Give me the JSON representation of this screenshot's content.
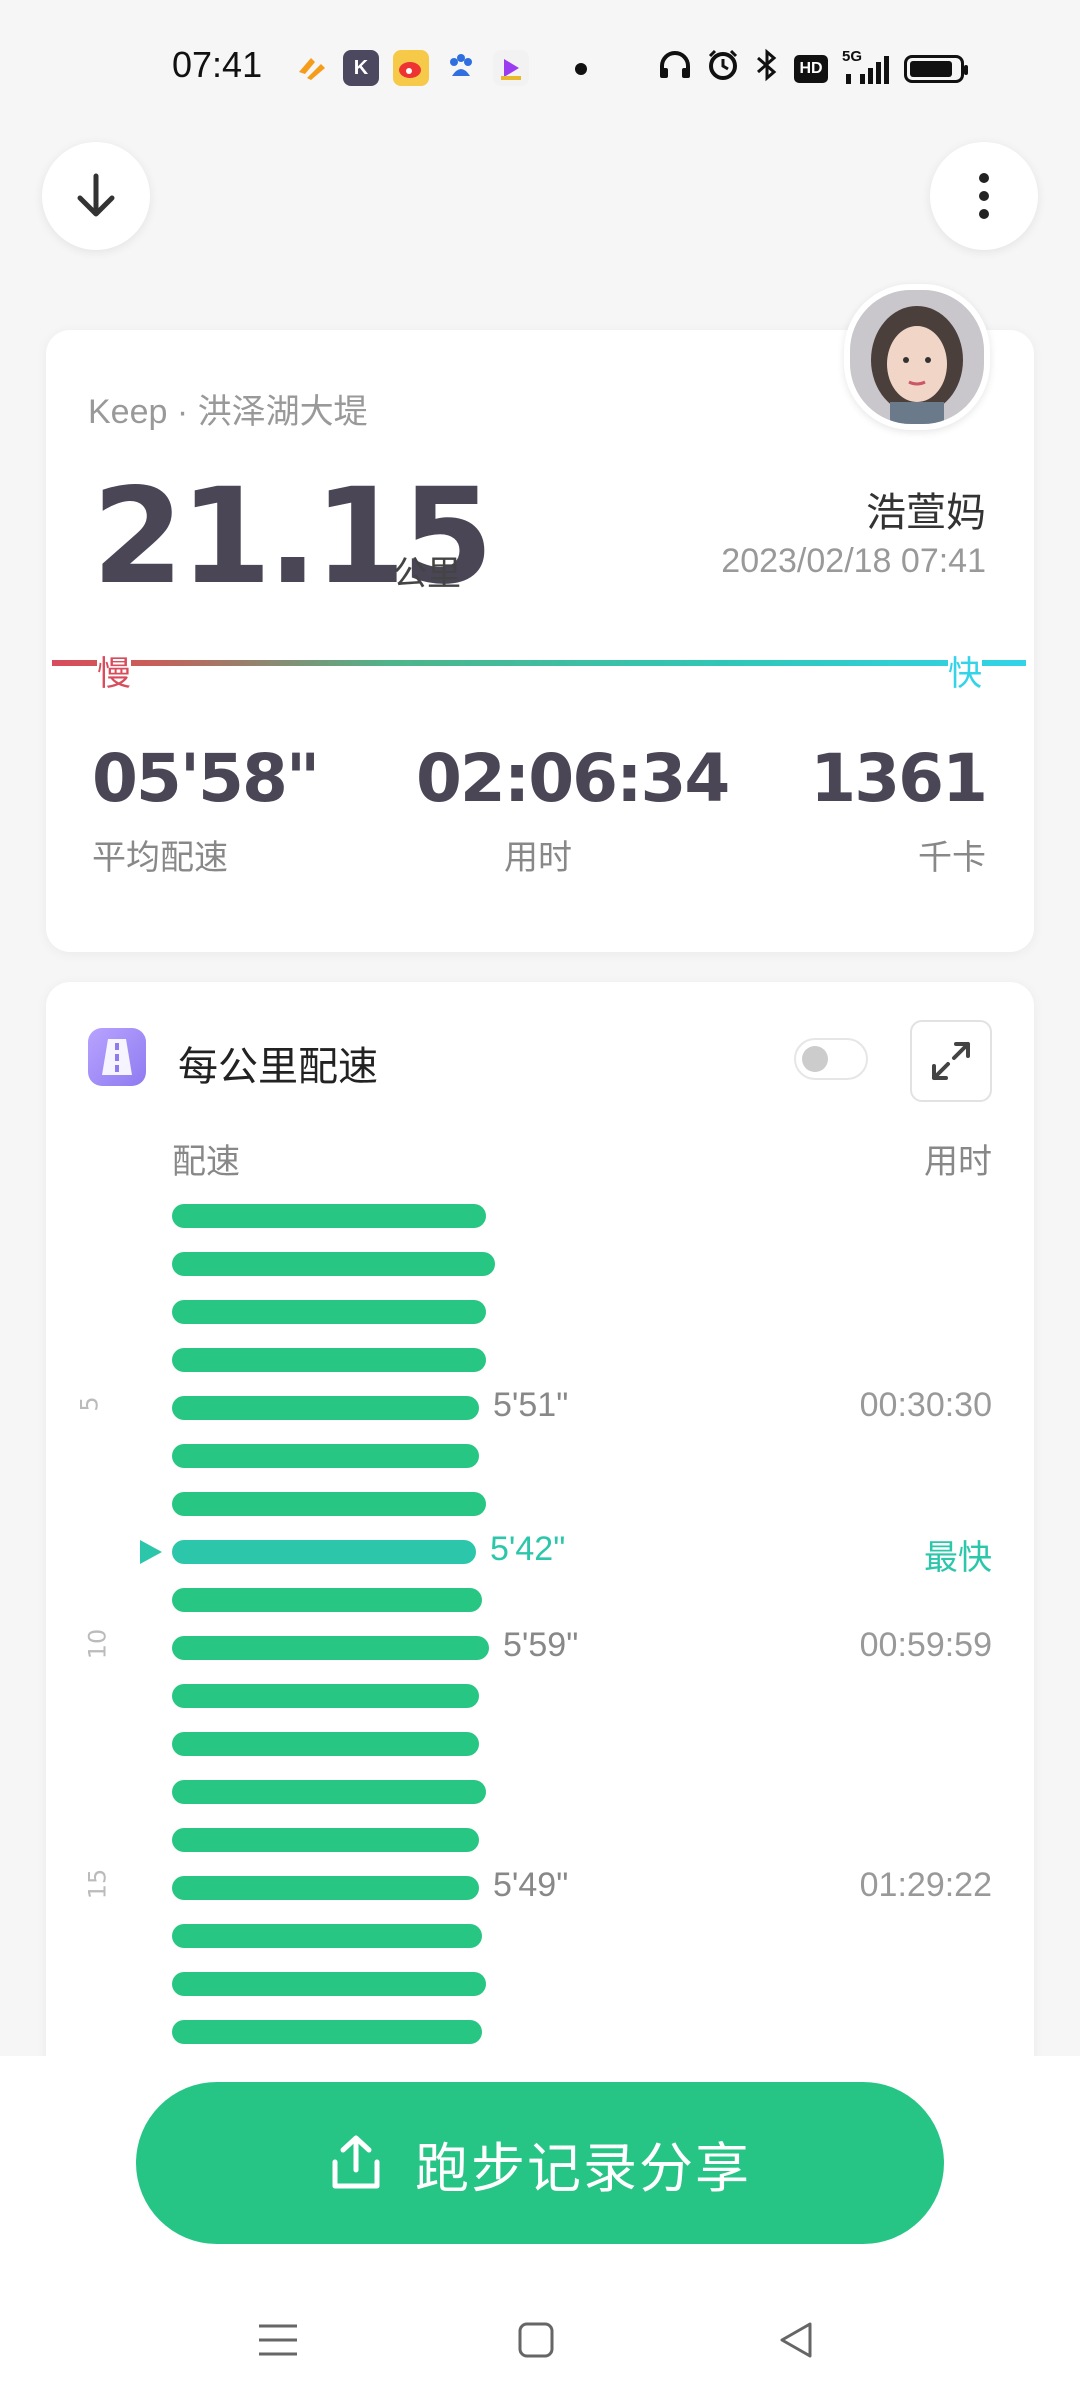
{
  "status_bar": {
    "time": "07:41",
    "app_icons": [
      "huawei-health-icon",
      "k-app-icon",
      "weibo-icon",
      "baidu-icon",
      "video-app-icon"
    ],
    "system_icons": [
      "headphones-icon",
      "alarm-icon",
      "bluetooth-icon",
      "hd-icon",
      "5g-signal-icon",
      "battery-icon"
    ],
    "hd_label": "HD",
    "network_label": "5G"
  },
  "header": {
    "download_icon": "arrow-down-icon",
    "more_icon": "more-vertical-icon"
  },
  "summary": {
    "source": "Keep · 洪泽湖大堤",
    "distance": "21.15",
    "distance_unit": "公里",
    "username": "浩萱妈",
    "datetime": "2023/02/18 07:41",
    "slow_label": "慢",
    "fast_label": "快",
    "stats": [
      {
        "value": "05'58\"",
        "label": "平均配速"
      },
      {
        "value": "02:06:34",
        "label": "用时"
      },
      {
        "value": "1361",
        "label": "千卡"
      }
    ]
  },
  "pace_card": {
    "title": "每公里配速",
    "toggle_on": false,
    "pace_column": "配速",
    "time_column": "用时",
    "km_marks": [
      "5",
      "10",
      "15"
    ],
    "fastest_label": "最快",
    "colors": {
      "bar": "#28c683",
      "fastest": "#2cc7ab"
    },
    "rows": [
      {
        "km": 1,
        "rel": 0.95
      },
      {
        "km": 2,
        "rel": 0.98
      },
      {
        "km": 3,
        "rel": 0.95
      },
      {
        "km": 4,
        "rel": 0.95
      },
      {
        "km": 5,
        "rel": 0.93,
        "pace": "5'51\"",
        "time": "00:30:30"
      },
      {
        "km": 6,
        "rel": 0.93
      },
      {
        "km": 7,
        "rel": 0.95
      },
      {
        "km": 8,
        "rel": 0.92,
        "pace": "5'42\"",
        "time": "最快",
        "fastest": true
      },
      {
        "km": 9,
        "rel": 0.94
      },
      {
        "km": 10,
        "rel": 0.96,
        "pace": "5'59\"",
        "time": "00:59:59"
      },
      {
        "km": 11,
        "rel": 0.93
      },
      {
        "km": 12,
        "rel": 0.93
      },
      {
        "km": 13,
        "rel": 0.95
      },
      {
        "km": 14,
        "rel": 0.93
      },
      {
        "km": 15,
        "rel": 0.93,
        "pace": "5'49\"",
        "time": "01:29:22"
      },
      {
        "km": 16,
        "rel": 0.94
      },
      {
        "km": 17,
        "rel": 0.95
      },
      {
        "km": 18,
        "rel": 0.94
      }
    ]
  },
  "share": {
    "label": "跑步记录分享",
    "icon": "share-upload-icon"
  },
  "nav": {
    "items": [
      "menu-icon",
      "home-square-icon",
      "back-triangle-icon"
    ]
  }
}
